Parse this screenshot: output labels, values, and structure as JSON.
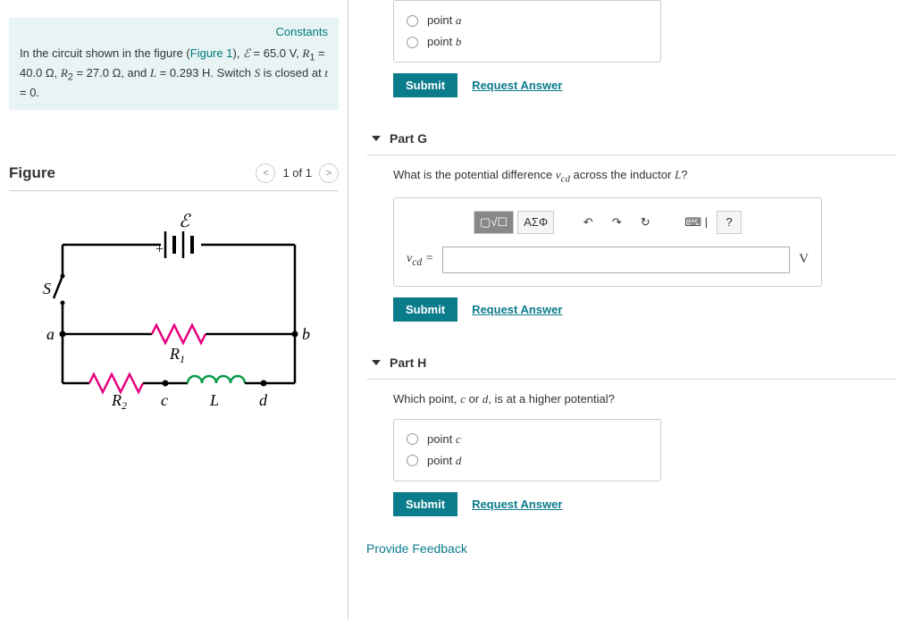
{
  "info": {
    "constants_label": "Constants",
    "text_pre": "In the circuit shown in the figure (",
    "figure_link": "Figure 1",
    "text_post": "), ",
    "E_sym": "ℰ",
    "E_val": " = 65.0 V",
    "R1_sym": "R",
    "R1_sub": "1",
    "R1_val": " = 40.0 Ω",
    "R2_sym": "R",
    "R2_sub": "2",
    "R2_val": " = 27.0 Ω",
    "L_sym": "L",
    "L_val": " = 0.293 H",
    "switch_text": ". Switch ",
    "S_sym": "S",
    "closed_text": " is closed at ",
    "t_sym": "t",
    "t_val": " = 0."
  },
  "figure": {
    "title": "Figure",
    "pager": "1 of 1"
  },
  "partF": {
    "opt_a": "point a",
    "opt_b": "point b",
    "submit": "Submit",
    "request": "Request Answer"
  },
  "partG": {
    "title": "Part G",
    "question_pre": "What is the potential difference ",
    "var": "v",
    "sub": "cd",
    "question_post": " across the inductor ",
    "L_sym": "L",
    "qmark": "?",
    "toolbar": {
      "templates": "▢√☐",
      "greek": "ΑΣΦ",
      "undo": "↶",
      "redo": "↷",
      "reset": "↻",
      "keyboard": "⌨ |",
      "help": "?"
    },
    "label": "v",
    "label_sub": "cd",
    "eq": " = ",
    "unit": "V",
    "submit": "Submit",
    "request": "Request Answer"
  },
  "partH": {
    "title": "Part H",
    "question_pre": "Which point, ",
    "c": "c",
    "or": " or ",
    "d": "d",
    "question_post": ", is at a higher potential?",
    "opt_c": "point c",
    "opt_d": "point d",
    "submit": "Submit",
    "request": "Request Answer"
  },
  "feedback": "Provide Feedback",
  "circuit": {
    "E": "ℰ",
    "S": "S",
    "a": "a",
    "b": "b",
    "c": "c",
    "d": "d",
    "R1": "R",
    "R1sub": "1",
    "R2": "R",
    "R2sub": "2",
    "L": "L",
    "plus": "+"
  }
}
